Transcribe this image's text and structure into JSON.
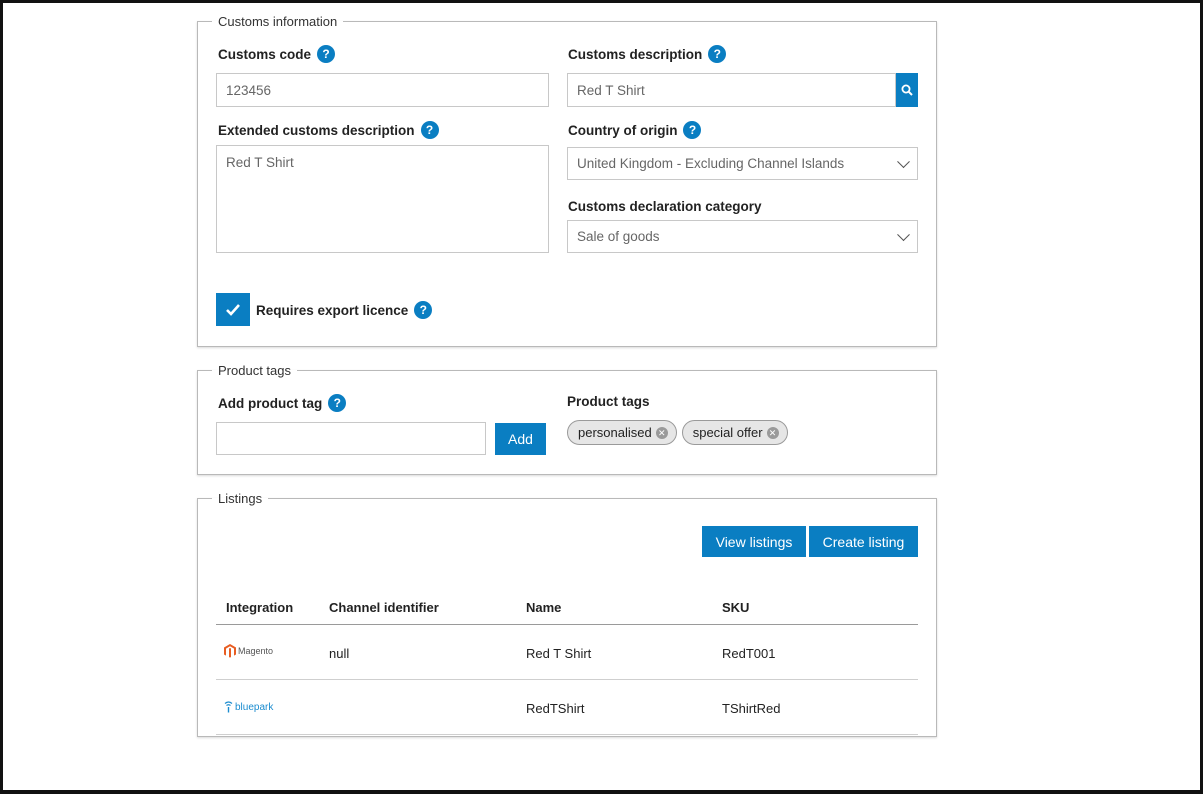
{
  "customs": {
    "legend": "Customs information",
    "code_label": "Customs code",
    "code_value": "123456",
    "description_label": "Customs description",
    "description_value": "Red T Shirt",
    "extended_label": "Extended customs description",
    "extended_value": "Red T Shirt",
    "country_label": "Country of origin",
    "country_value": "United Kingdom - Excluding Channel Islands",
    "category_label": "Customs declaration category",
    "category_value": "Sale of goods",
    "export_licence_label": "Requires export licence",
    "export_licence_checked": true
  },
  "tags": {
    "legend": "Product tags",
    "add_label": "Add product tag",
    "add_value": "",
    "add_button": "Add",
    "list_label": "Product tags",
    "items": [
      "personalised",
      "special offer"
    ]
  },
  "listings": {
    "legend": "Listings",
    "view_button": "View listings",
    "create_button": "Create listing",
    "columns": [
      "Integration",
      "Channel identifier",
      "Name",
      "SKU"
    ],
    "rows": [
      {
        "integration": "Magento",
        "integration_icon": "magento-logo",
        "channel_identifier": "null",
        "name": "Red T Shirt",
        "sku": "RedT001"
      },
      {
        "integration": "bluepark",
        "integration_icon": "bluepark-logo",
        "channel_identifier": "",
        "name": "RedTShirt",
        "sku": "TShirtRed"
      }
    ]
  },
  "colors": {
    "accent": "#0a7ec2",
    "magento": "#e85d22",
    "bluepark": "#1b8ccf"
  }
}
